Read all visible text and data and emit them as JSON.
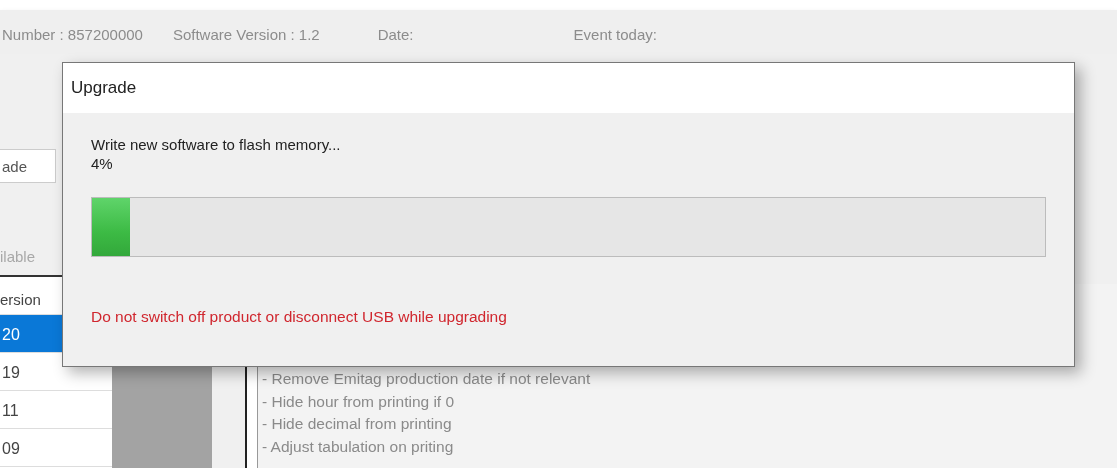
{
  "header": {
    "fields": [
      "Number : 857200000",
      "Software Version : 1.2",
      "Date:",
      "Event today:"
    ]
  },
  "tab": {
    "label": "ade",
    "selected": true
  },
  "section_label": "ilable",
  "versions": {
    "column": "ersion",
    "rows": [
      {
        "text": "20",
        "selected": true
      },
      {
        "text": "19",
        "selected": false
      },
      {
        "text": "11",
        "selected": false
      },
      {
        "text": "09",
        "selected": false
      }
    ]
  },
  "notes": [
    "- Remove Emitag production date if not relevant",
    "- Hide hour from printing if 0",
    "- Hide decimal from printing",
    "- Adjust tabulation on priting"
  ],
  "dialog": {
    "title": "Upgrade",
    "message": "Write new software to flash memory...",
    "percent": "4%",
    "progress": {
      "level": 0.04
    },
    "warning": "Do not switch off product or disconnect USB while upgrading"
  }
}
